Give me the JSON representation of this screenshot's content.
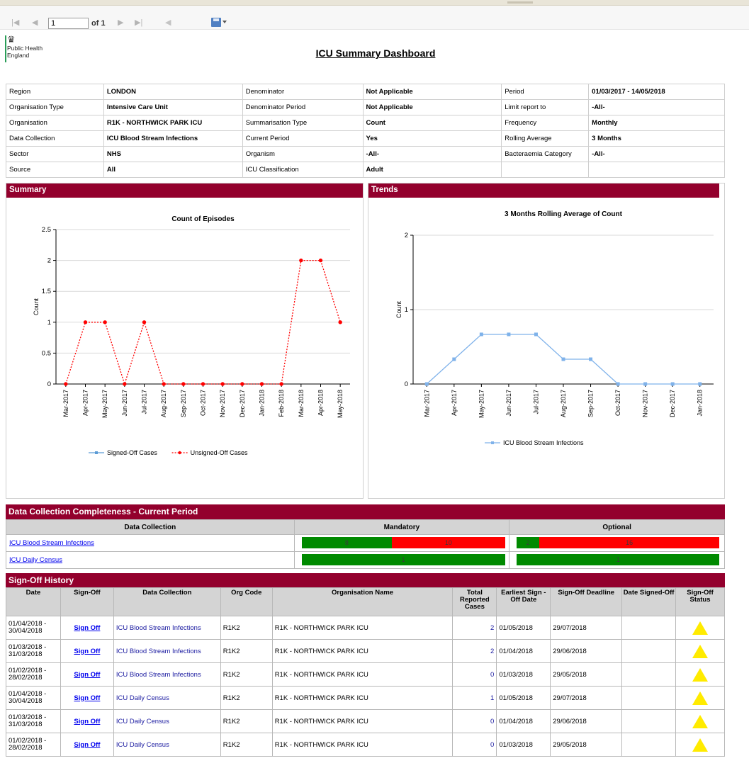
{
  "toolbar": {
    "page_value": "1",
    "of_label": "of 1"
  },
  "header": {
    "logo_text_1": "Public Health",
    "logo_text_2": "England",
    "title": "ICU Summary Dashboard"
  },
  "params": [
    [
      "Region",
      "LONDON",
      "Denominator",
      "Not Applicable",
      "Period",
      "01/03/2017 - 14/05/2018"
    ],
    [
      "Organisation Type",
      "Intensive Care Unit",
      "Denominator Period",
      "Not Applicable",
      "Limit report to",
      "-All-"
    ],
    [
      "Organisation",
      "R1K - NORTHWICK PARK ICU",
      "Summarisation Type",
      "Count",
      "Frequency",
      "Monthly"
    ],
    [
      "Data Collection",
      "ICU Blood Stream Infections",
      "Current Period",
      "Yes",
      "Rolling Average",
      "3 Months"
    ],
    [
      "Sector",
      "NHS",
      "Organism",
      "-All-",
      "Bacteraemia Category",
      "-All-"
    ],
    [
      "Source",
      "All",
      "ICU Classification",
      "Adult",
      "",
      ""
    ]
  ],
  "summary": {
    "heading": "Summary"
  },
  "trends": {
    "heading": "Trends"
  },
  "chart_data": [
    {
      "type": "line",
      "title": "Count of Episodes",
      "ylabel": "Count",
      "xlabel": "",
      "ylim": [
        0,
        2.5
      ],
      "yticks": [
        "0",
        "0.5",
        "1",
        "1.5",
        "2",
        "2.5"
      ],
      "categories": [
        "Mar-2017",
        "Apr-2017",
        "May-2017",
        "Jun-2017",
        "Jul-2017",
        "Aug-2017",
        "Sep-2017",
        "Oct-2017",
        "Nov-2017",
        "Dec-2017",
        "Jan-2018",
        "Feb-2018",
        "Mar-2018",
        "Apr-2018",
        "May-2018"
      ],
      "series": [
        {
          "name": "Signed-Off Cases",
          "color": "#5b9bd5",
          "values": []
        },
        {
          "name": "Unsigned-Off Cases",
          "color": "#ff0000",
          "values": [
            0,
            1,
            1,
            0,
            1,
            0,
            0,
            0,
            0,
            0,
            0,
            0,
            2,
            2,
            1
          ]
        }
      ],
      "legend": "bottom"
    },
    {
      "type": "line",
      "title": "3 Months Rolling Average of Count",
      "ylabel": "Count",
      "xlabel": "",
      "ylim": [
        0,
        2
      ],
      "yticks": [
        "0",
        "1",
        "2"
      ],
      "categories": [
        "Mar-2017",
        "Apr-2017",
        "May-2017",
        "Jun-2017",
        "Jul-2017",
        "Aug-2017",
        "Sep-2017",
        "Oct-2017",
        "Nov-2017",
        "Dec-2017",
        "Jan-2018"
      ],
      "series": [
        {
          "name": "ICU Blood Stream Infections",
          "color": "#7fb2ea",
          "values": [
            0,
            0.333,
            0.667,
            0.667,
            0.667,
            0.333,
            0.333,
            0,
            0,
            0,
            0
          ]
        }
      ],
      "legend": "bottom"
    }
  ],
  "completeness": {
    "heading": "Data Collection Completeness - Current Period",
    "col_collection": "Data Collection",
    "col_mandatory": "Mandatory",
    "col_optional": "Optional",
    "rows": [
      {
        "name": "ICU Blood Stream Infections",
        "mand_green": 8,
        "mand_red": 10,
        "opt_green": 2,
        "opt_red": 16
      },
      {
        "name": "ICU Daily Census",
        "mand_green": 1,
        "mand_red": 0,
        "opt_green": 1,
        "opt_red": 0
      }
    ],
    "green": "#008a00",
    "red": "#ff0000"
  },
  "history": {
    "heading": "Sign-Off History",
    "columns": [
      "Date",
      "Sign-Off",
      "Data Collection",
      "Org Code",
      "Organisation Name",
      "Total Reported Cases",
      "Earliest Sign -Off Date",
      "Sign-Off Deadline",
      "Date Signed-Off",
      "Sign-Off Status"
    ],
    "rows": [
      {
        "date1": "01/04/2018 -",
        "date2": "30/04/2018",
        "signoff": "Sign Off",
        "dc": "ICU Blood Stream Infections",
        "code": "R1K2",
        "org": "R1K - NORTHWICK PARK ICU",
        "cases": "2",
        "earliest": "01/05/2018",
        "deadline": "29/07/2018",
        "signed": "",
        "status": "warning-icon"
      },
      {
        "date1": "01/03/2018 -",
        "date2": "31/03/2018",
        "signoff": "Sign Off",
        "dc": "ICU Blood Stream Infections",
        "code": "R1K2",
        "org": "R1K - NORTHWICK PARK ICU",
        "cases": "2",
        "earliest": "01/04/2018",
        "deadline": "29/06/2018",
        "signed": "",
        "status": "warning-icon"
      },
      {
        "date1": "01/02/2018 -",
        "date2": "28/02/2018",
        "signoff": "Sign Off",
        "dc": "ICU Blood Stream Infections",
        "code": "R1K2",
        "org": "R1K - NORTHWICK PARK ICU",
        "cases": "0",
        "earliest": "01/03/2018",
        "deadline": "29/05/2018",
        "signed": "",
        "status": "warning-icon"
      },
      {
        "date1": "01/04/2018 -",
        "date2": "30/04/2018",
        "signoff": "Sign Off",
        "dc": "ICU Daily Census",
        "code": "R1K2",
        "org": "R1K - NORTHWICK PARK ICU",
        "cases": "1",
        "earliest": "01/05/2018",
        "deadline": "29/07/2018",
        "signed": "",
        "status": "warning-icon"
      },
      {
        "date1": "01/03/2018 -",
        "date2": "31/03/2018",
        "signoff": "Sign Off",
        "dc": "ICU Daily Census",
        "code": "R1K2",
        "org": "R1K - NORTHWICK PARK ICU",
        "cases": "0",
        "earliest": "01/04/2018",
        "deadline": "29/06/2018",
        "signed": "",
        "status": "warning-icon"
      },
      {
        "date1": "01/02/2018 -",
        "date2": "28/02/2018",
        "signoff": "Sign Off",
        "dc": "ICU Daily Census",
        "code": "R1K2",
        "org": "R1K - NORTHWICK PARK ICU",
        "cases": "0",
        "earliest": "01/03/2018",
        "deadline": "29/05/2018",
        "signed": "",
        "status": "warning-icon"
      }
    ]
  }
}
